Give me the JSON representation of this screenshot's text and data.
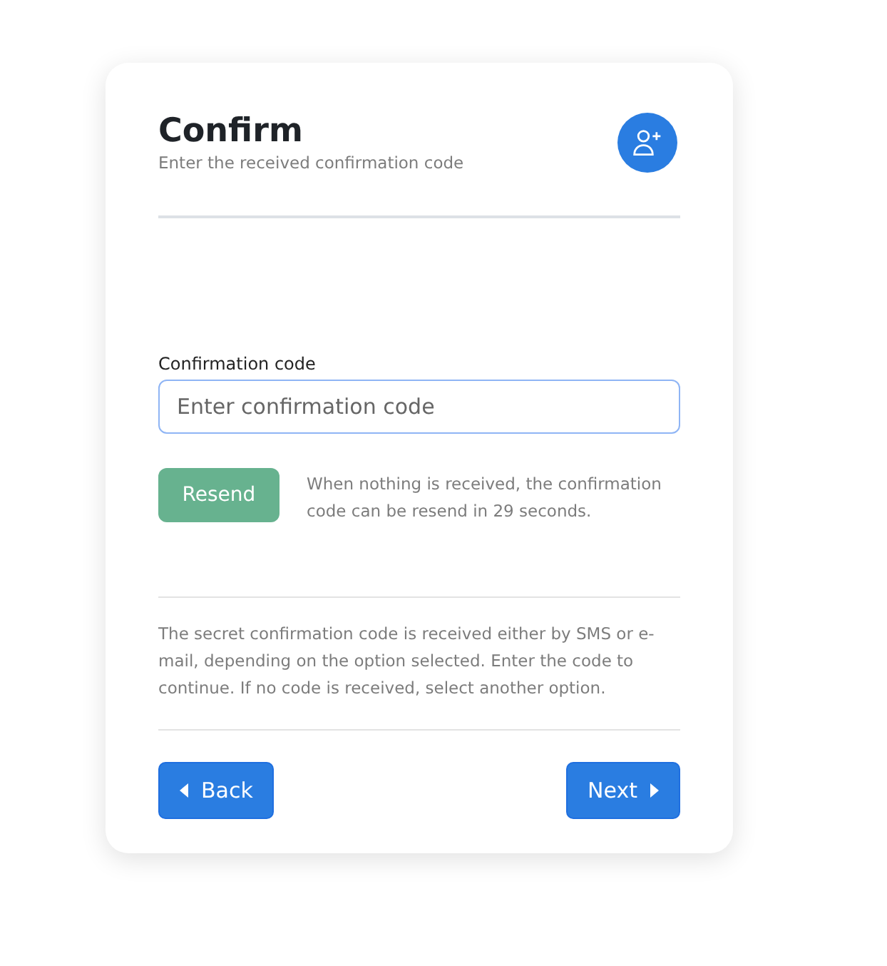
{
  "header": {
    "title": "Confirm",
    "subtitle": "Enter the received confirmation code"
  },
  "field": {
    "label": "Confirmation code",
    "placeholder": "Enter confirmation code"
  },
  "resend": {
    "label": "Resend",
    "disabled": true,
    "note": "When nothing is received, the confirmation code can be resend in 29 seconds."
  },
  "info": "The secret confirmation code is received either by SMS or e-mail, depending on the option selected. Enter the code to continue. If no code is received, select another option.",
  "buttons": [
    {
      "kind": "back",
      "label": "Back"
    },
    {
      "kind": "next",
      "label": "Next"
    }
  ]
}
